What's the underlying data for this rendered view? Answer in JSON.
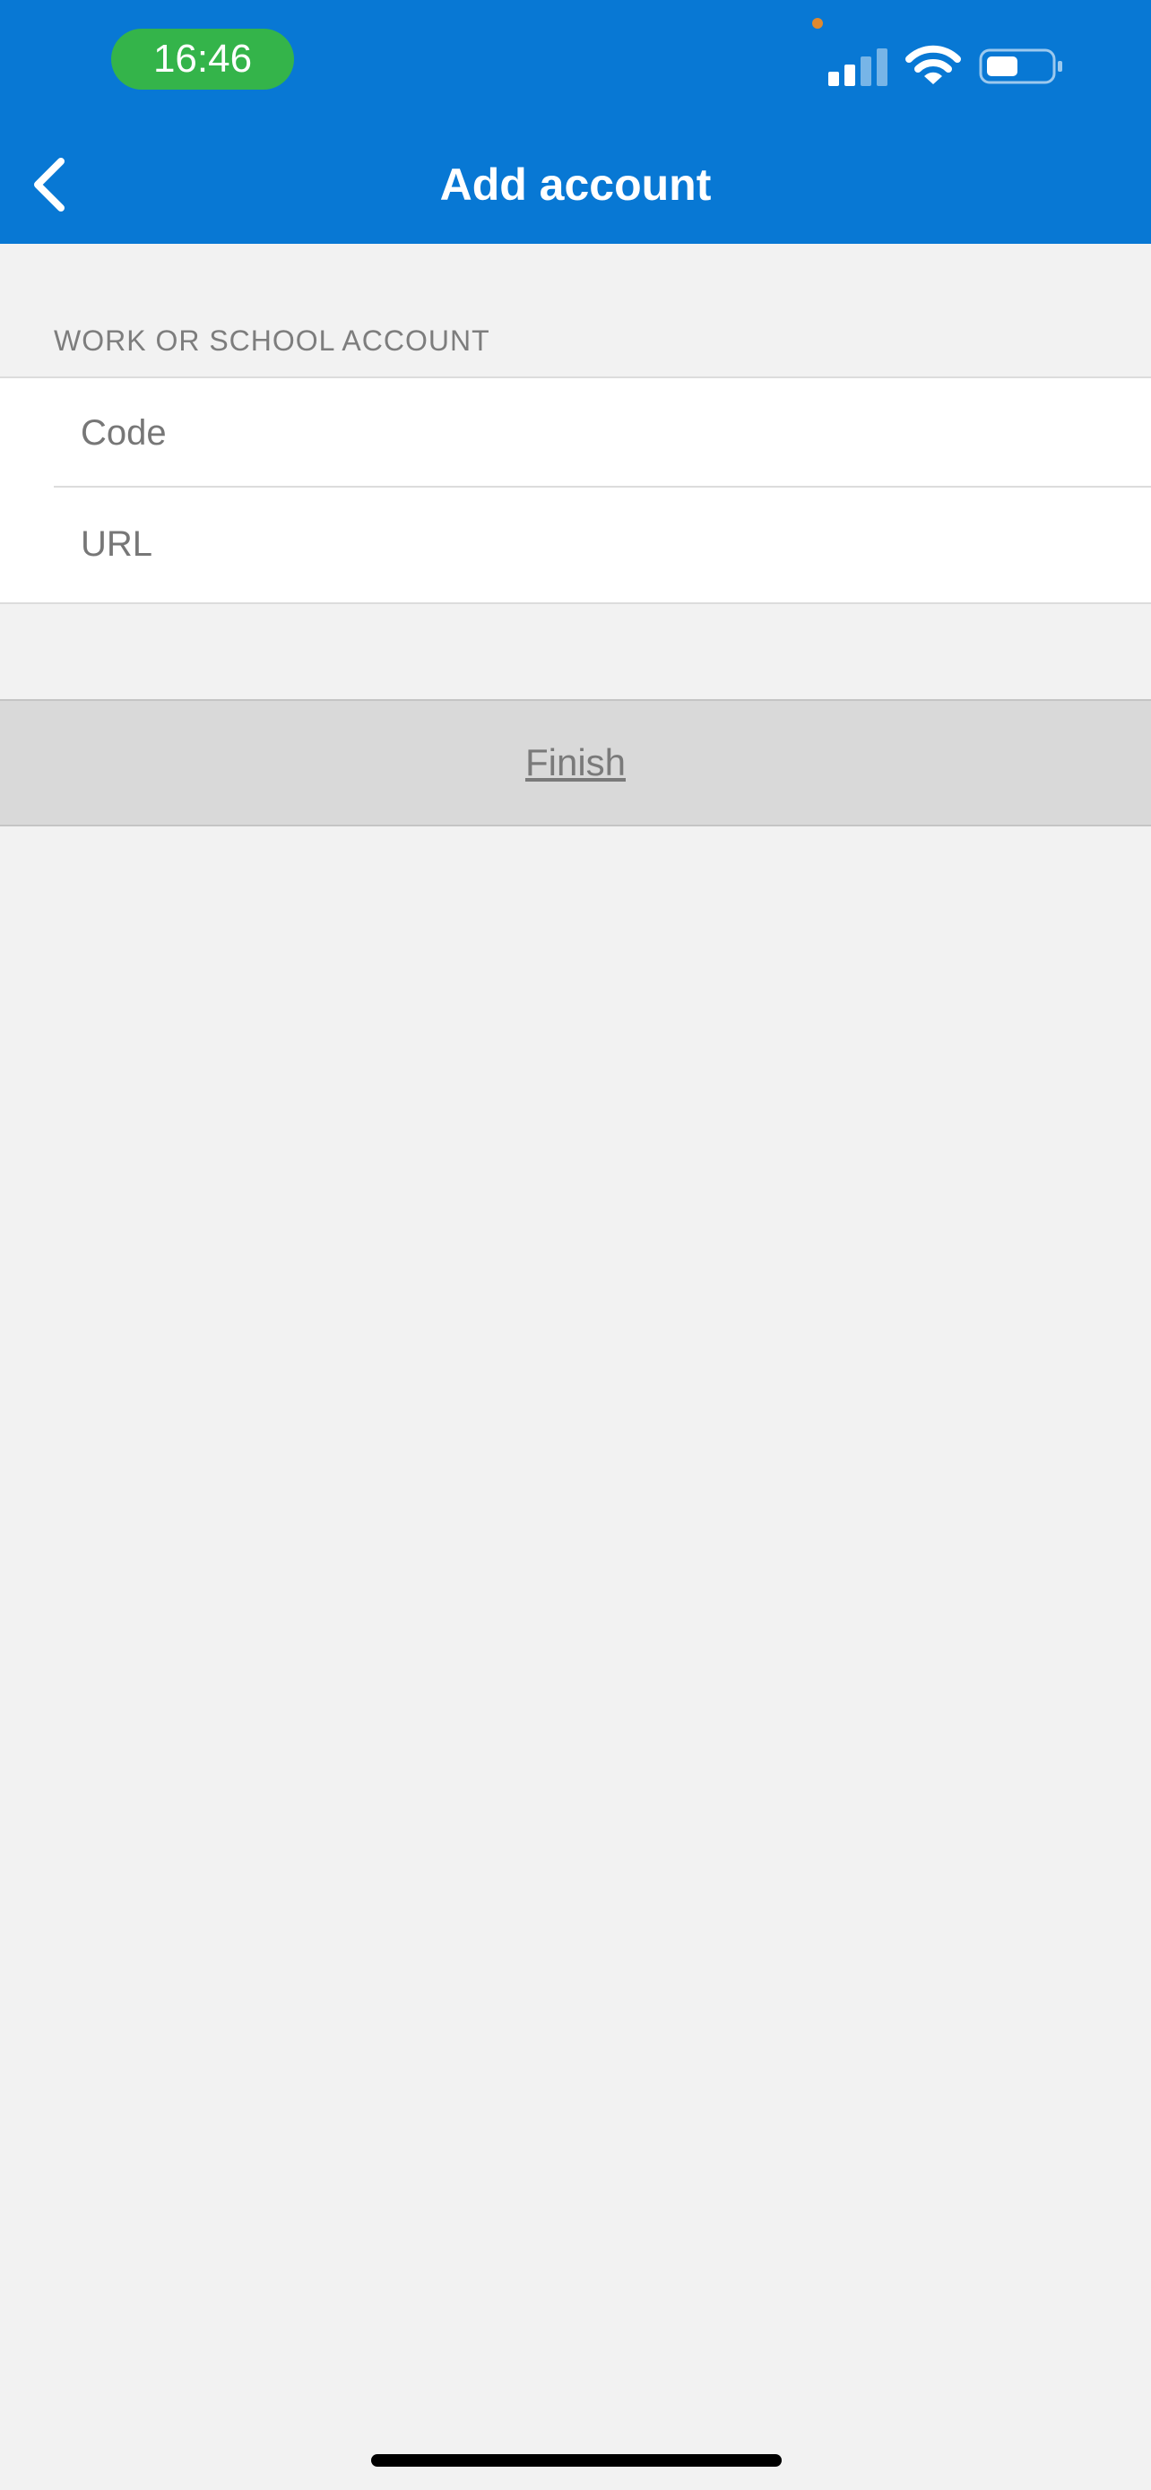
{
  "status_bar": {
    "time": "16:46",
    "icons": [
      "signal-icon",
      "wifi-icon",
      "battery-icon"
    ],
    "pill_color": "#34b44a"
  },
  "header": {
    "title": "Add account",
    "back_icon": "chevron-left-icon",
    "background_color": "#0878d4"
  },
  "form": {
    "section_header": "WORK OR SCHOOL ACCOUNT",
    "code_placeholder": "Code",
    "url_placeholder": "URL"
  },
  "actions": {
    "finish_label": "Finish"
  }
}
